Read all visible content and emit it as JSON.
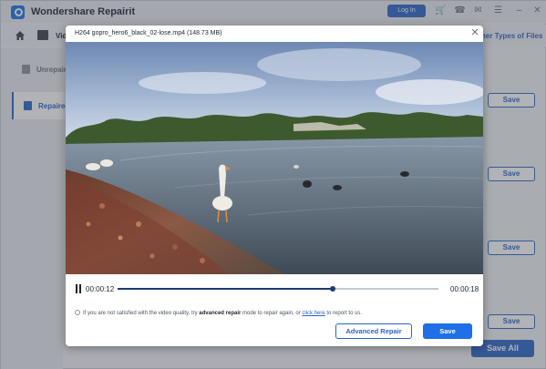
{
  "app": {
    "title": "Wondershare Repairit",
    "login_label": "Log In",
    "nav_video_label": "Vid",
    "other_types_link": "her Types of Files",
    "sidebar": [
      {
        "label": "Unrepair"
      },
      {
        "label": "Repaired"
      }
    ],
    "row_save_label": "Save",
    "save_all_label": "Save All"
  },
  "modal": {
    "title": "H264 gopro_hero6_black_02-lose.mp4 (148.73  MB)",
    "time_current": "00:00:12",
    "time_total": "00:00:18",
    "progress": 0.67,
    "info_pre": "If you are not satisfied with the video quality, try ",
    "info_bold": "advanced repair",
    "info_mid": " mode to repair again, or ",
    "info_link": "click here",
    "info_post": " to report to us.",
    "advanced_repair_label": "Advanced Repair",
    "save_label": "Save"
  },
  "colors": {
    "accent": "#2a64c8",
    "primary_button": "#1f6fe8"
  }
}
